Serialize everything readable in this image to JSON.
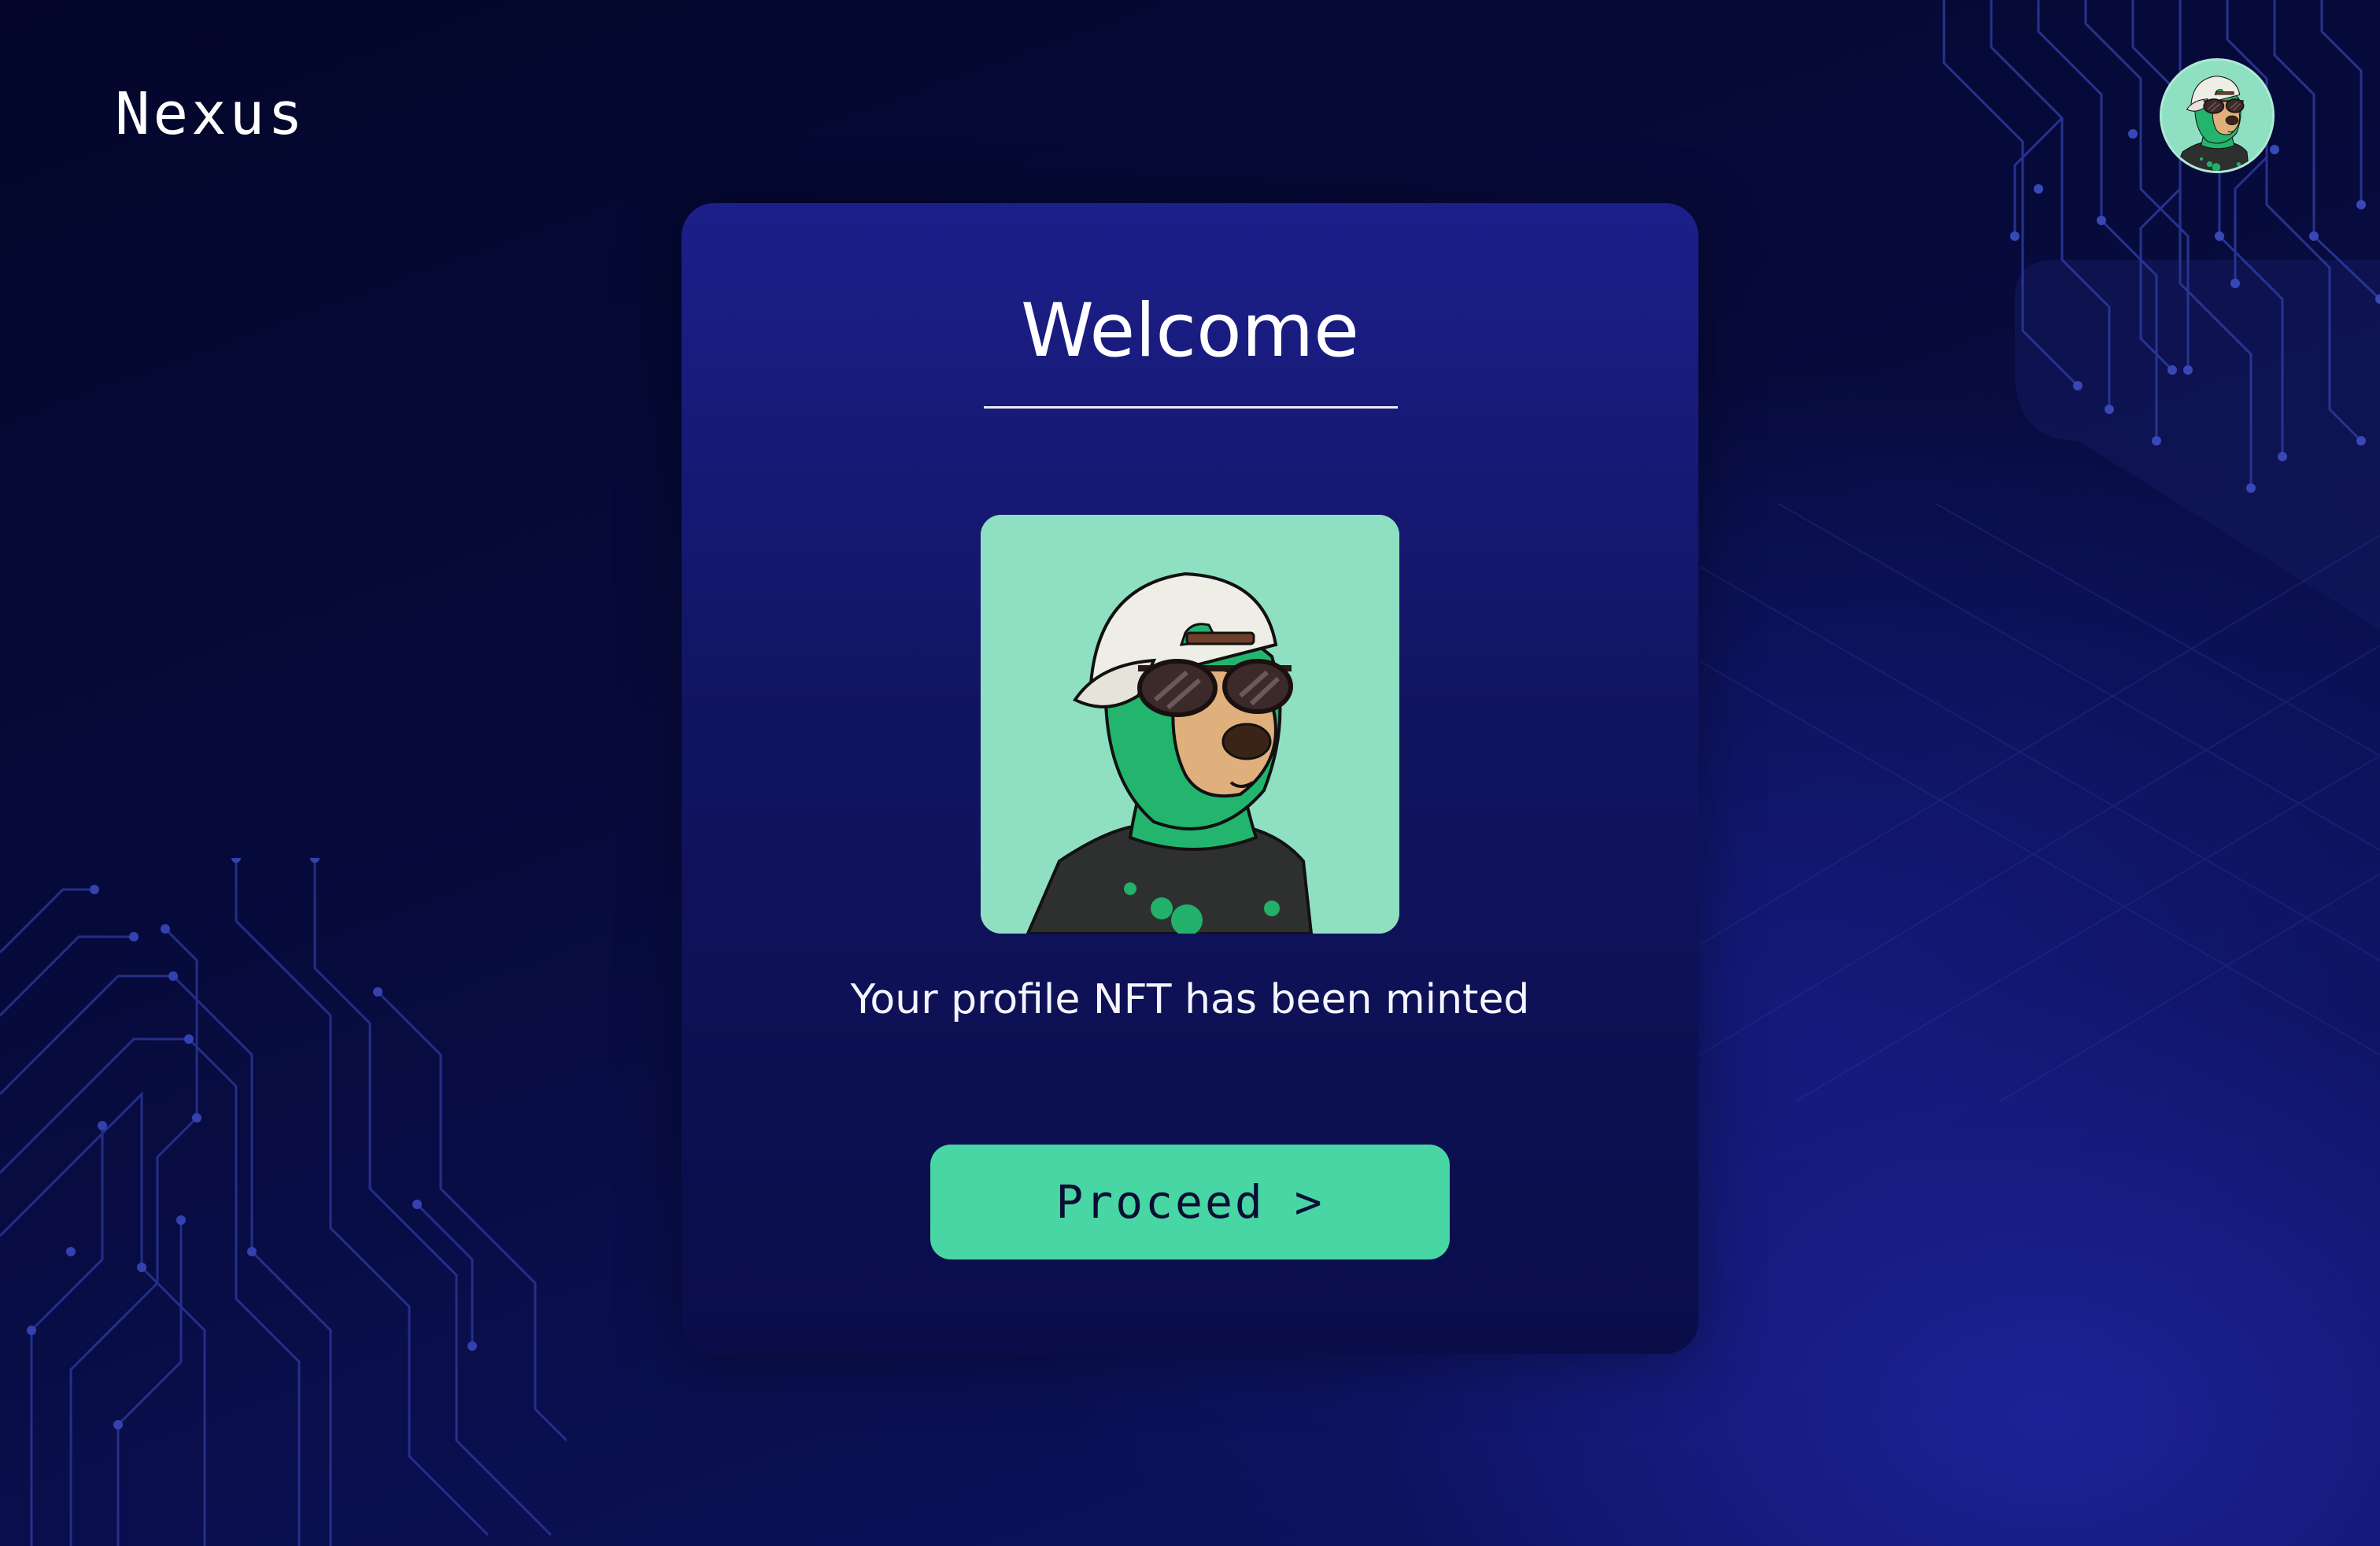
{
  "header": {
    "brand": "Nexus"
  },
  "user": {
    "avatar_icon": "bear-nft-avatar"
  },
  "welcome_card": {
    "title": "Welcome",
    "image_icon": "bear-nft-artwork",
    "message": "Your profile NFT has been minted",
    "proceed_label": "Proceed >"
  },
  "colors": {
    "background": "#070b3d",
    "card_top": "#1c1f8a",
    "card_bottom": "#0a0d48",
    "accent": "#48d6a4",
    "nft_background": "#8fe0c2",
    "button_text": "#0b0d34"
  }
}
